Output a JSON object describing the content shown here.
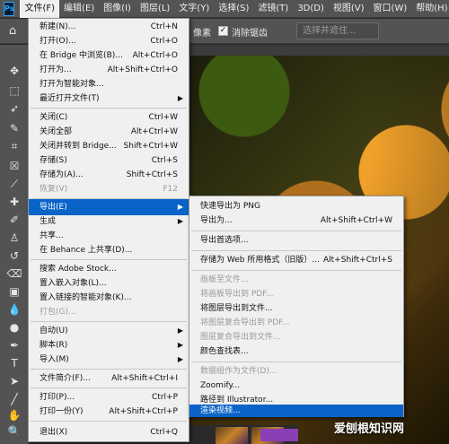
{
  "app": {
    "logo_text": "Ps"
  },
  "menubar": {
    "items": [
      "文件(F)",
      "编辑(E)",
      "图像(I)",
      "图层(L)",
      "文字(Y)",
      "选择(S)",
      "滤镜(T)",
      "3D(D)",
      "视图(V)",
      "窗口(W)",
      "帮助(H)"
    ],
    "active_index": 0
  },
  "options_bar": {
    "home_icon": "home-icon",
    "pixel_label": "像素",
    "anti_alias_label": "消除锯齿",
    "anti_alias_checked": true,
    "select_subject_label": "选择并遮住..."
  },
  "file_menu": {
    "items": [
      {
        "label": "新建(N)...",
        "shortcut": "Ctrl+N",
        "enabled": true
      },
      {
        "label": "打开(O)...",
        "shortcut": "Ctrl+O",
        "enabled": true
      },
      {
        "label": "在 Bridge 中浏览(B)...",
        "shortcut": "Alt+Ctrl+O",
        "enabled": true
      },
      {
        "label": "打开为...",
        "shortcut": "Alt+Shift+Ctrl+O",
        "enabled": true
      },
      {
        "label": "打开为智能对象...",
        "shortcut": "",
        "enabled": true
      },
      {
        "label": "最近打开文件(T)",
        "shortcut": "",
        "enabled": true,
        "submenu": true
      },
      {
        "label": "关闭(C)",
        "shortcut": "Ctrl+W",
        "enabled": true
      },
      {
        "label": "关闭全部",
        "shortcut": "Alt+Ctrl+W",
        "enabled": true
      },
      {
        "label": "关闭并转到 Bridge...",
        "shortcut": "Shift+Ctrl+W",
        "enabled": true
      },
      {
        "label": "存储(S)",
        "shortcut": "Ctrl+S",
        "enabled": true
      },
      {
        "label": "存储为(A)...",
        "shortcut": "Shift+Ctrl+S",
        "enabled": true
      },
      {
        "label": "恢复(V)",
        "shortcut": "F12",
        "enabled": false
      },
      {
        "label": "导出(E)",
        "shortcut": "",
        "enabled": true,
        "submenu": true,
        "highlighted": true
      },
      {
        "label": "生成",
        "shortcut": "",
        "enabled": true,
        "submenu": true
      },
      {
        "label": "共享...",
        "shortcut": "",
        "enabled": true
      },
      {
        "label": "在 Behance 上共享(D)...",
        "shortcut": "",
        "enabled": true
      },
      {
        "label": "搜索 Adobe Stock...",
        "shortcut": "",
        "enabled": true
      },
      {
        "label": "置入嵌入对象(L)...",
        "shortcut": "",
        "enabled": true
      },
      {
        "label": "置入链接的智能对象(K)...",
        "shortcut": "",
        "enabled": true
      },
      {
        "label": "打包(G)...",
        "shortcut": "",
        "enabled": false
      },
      {
        "label": "自动(U)",
        "shortcut": "",
        "enabled": true,
        "submenu": true
      },
      {
        "label": "脚本(R)",
        "shortcut": "",
        "enabled": true,
        "submenu": true
      },
      {
        "label": "导入(M)",
        "shortcut": "",
        "enabled": true,
        "submenu": true
      },
      {
        "label": "文件简介(F)...",
        "shortcut": "Alt+Shift+Ctrl+I",
        "enabled": true
      },
      {
        "label": "打印(P)...",
        "shortcut": "Ctrl+P",
        "enabled": true
      },
      {
        "label": "打印一份(Y)",
        "shortcut": "Alt+Shift+Ctrl+P",
        "enabled": true
      },
      {
        "label": "退出(X)",
        "shortcut": "Ctrl+Q",
        "enabled": true
      }
    ]
  },
  "export_submenu": {
    "items": [
      {
        "label": "快速导出为 PNG",
        "shortcut": "",
        "enabled": true
      },
      {
        "label": "导出为...",
        "shortcut": "Alt+Shift+Ctrl+W",
        "enabled": true
      },
      {
        "label": "导出首选项...",
        "shortcut": "",
        "enabled": true
      },
      {
        "label": "存储为 Web 所用格式（旧版）...",
        "shortcut": "Alt+Shift+Ctrl+S",
        "enabled": true
      },
      {
        "label": "画板至文件...",
        "shortcut": "",
        "enabled": false
      },
      {
        "label": "将画板导出到 PDF...",
        "shortcut": "",
        "enabled": false
      },
      {
        "label": "将图层导出到文件...",
        "shortcut": "",
        "enabled": true
      },
      {
        "label": "将图层复合导出到 PDF...",
        "shortcut": "",
        "enabled": false
      },
      {
        "label": "图层复合导出到文件...",
        "shortcut": "",
        "enabled": false
      },
      {
        "label": "颜色查找表...",
        "shortcut": "",
        "enabled": true
      },
      {
        "label": "数据组作为文件(D)...",
        "shortcut": "",
        "enabled": false
      },
      {
        "label": "Zoomify...",
        "shortcut": "",
        "enabled": true
      },
      {
        "label": "路径到 Illustrator...",
        "shortcut": "",
        "enabled": true
      },
      {
        "label": "渲染视频...",
        "shortcut": "",
        "enabled": true,
        "highlighted": true
      }
    ]
  },
  "watermark": "爱刨根知识网"
}
